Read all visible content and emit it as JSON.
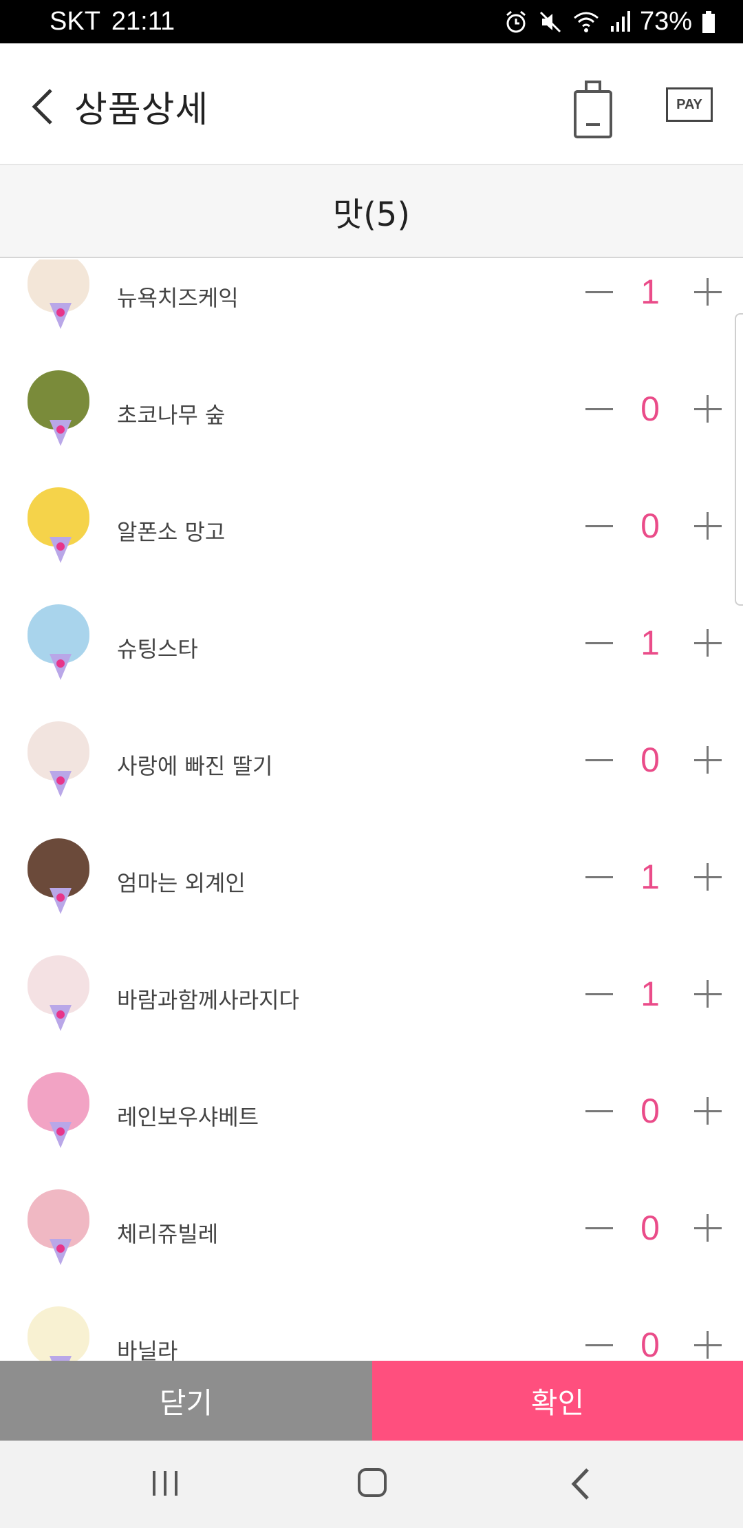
{
  "status_bar": {
    "carrier": "SKT",
    "time": "21:11",
    "battery": "73%",
    "icons": [
      "alarm-icon",
      "mute-icon",
      "wifi-icon",
      "signal-icon",
      "battery-icon"
    ]
  },
  "header": {
    "title": "상품상세",
    "pay_label": "PAY",
    "icons": [
      "back-arrow-icon",
      "shopping-bag-icon"
    ]
  },
  "section": {
    "title": "맛(5)"
  },
  "colors": {
    "accent": "#ff4f7e",
    "quantity": "#ea4c89",
    "close_button": "#8e8e8e"
  },
  "flavors": [
    {
      "name": "뉴욕치즈케익",
      "qty": "1",
      "scoop_color": "#f3e6d8"
    },
    {
      "name": "초코나무 숲",
      "qty": "0",
      "scoop_color": "#7a8b3a"
    },
    {
      "name": "알폰소 망고",
      "qty": "0",
      "scoop_color": "#f5d34a"
    },
    {
      "name": "슈팅스타",
      "qty": "1",
      "scoop_color": "#a9d4ec"
    },
    {
      "name": "사랑에 빠진 딸기",
      "qty": "0",
      "scoop_color": "#f2e4df"
    },
    {
      "name": "엄마는 외계인",
      "qty": "1",
      "scoop_color": "#6b4a3a"
    },
    {
      "name": "바람과함께사라지다",
      "qty": "1",
      "scoop_color": "#f4e1e3"
    },
    {
      "name": "레인보우샤베트",
      "qty": "0",
      "scoop_color": "#f2a3c4"
    },
    {
      "name": "체리쥬빌레",
      "qty": "0",
      "scoop_color": "#f0b8c3"
    },
    {
      "name": "바닐라",
      "qty": "0",
      "scoop_color": "#f8f1d2"
    }
  ],
  "footer": {
    "close_label": "닫기",
    "confirm_label": "확인"
  },
  "nav": {
    "icons": [
      "recent-apps-icon",
      "home-icon",
      "back-icon"
    ]
  }
}
